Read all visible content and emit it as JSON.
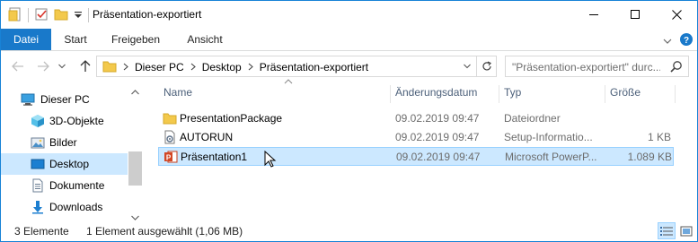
{
  "window": {
    "title": "Präsentation-exportiert",
    "controls": {
      "minimize": "minimize-icon",
      "maximize": "maximize-icon",
      "close": "close-icon"
    }
  },
  "ribbon": {
    "tabs": [
      {
        "label": "Datei",
        "active": true
      },
      {
        "label": "Start"
      },
      {
        "label": "Freigeben"
      },
      {
        "label": "Ansicht"
      }
    ]
  },
  "addressbar": {
    "breadcrumb": [
      "Dieser PC",
      "Desktop",
      "Präsentation-exportiert"
    ],
    "search_placeholder": "\"Präsentation-exportiert\" durc..."
  },
  "navpane": {
    "items": [
      {
        "label": "Dieser PC",
        "icon": "computer-icon"
      },
      {
        "label": "3D-Objekte",
        "icon": "3d-objects-icon"
      },
      {
        "label": "Bilder",
        "icon": "pictures-icon"
      },
      {
        "label": "Desktop",
        "icon": "desktop-icon",
        "selected": true
      },
      {
        "label": "Dokumente",
        "icon": "documents-icon"
      },
      {
        "label": "Downloads",
        "icon": "downloads-icon"
      }
    ]
  },
  "filelist": {
    "columns": {
      "name": "Name",
      "date": "Änderungsdatum",
      "type": "Typ",
      "size": "Größe"
    },
    "rows": [
      {
        "name": "PresentationPackage",
        "date": "09.02.2019 09:47",
        "type": "Dateiordner",
        "size": "",
        "icon": "folder-icon"
      },
      {
        "name": "AUTORUN",
        "date": "09.02.2019 09:47",
        "type": "Setup-Informatio...",
        "size": "1 KB",
        "icon": "setup-info-icon"
      },
      {
        "name": "Präsentation1",
        "date": "09.02.2019 09:47",
        "type": "Microsoft PowerP...",
        "size": "1.089 KB",
        "icon": "powerpoint-icon",
        "selected": true
      }
    ]
  },
  "statusbar": {
    "count": "3 Elemente",
    "selection": "1 Element ausgewählt (1,06 MB)"
  },
  "colors": {
    "accent": "#1979ca",
    "selection_bg": "#cce8ff",
    "selection_border": "#99d1ff",
    "header_text": "#4c607a"
  }
}
